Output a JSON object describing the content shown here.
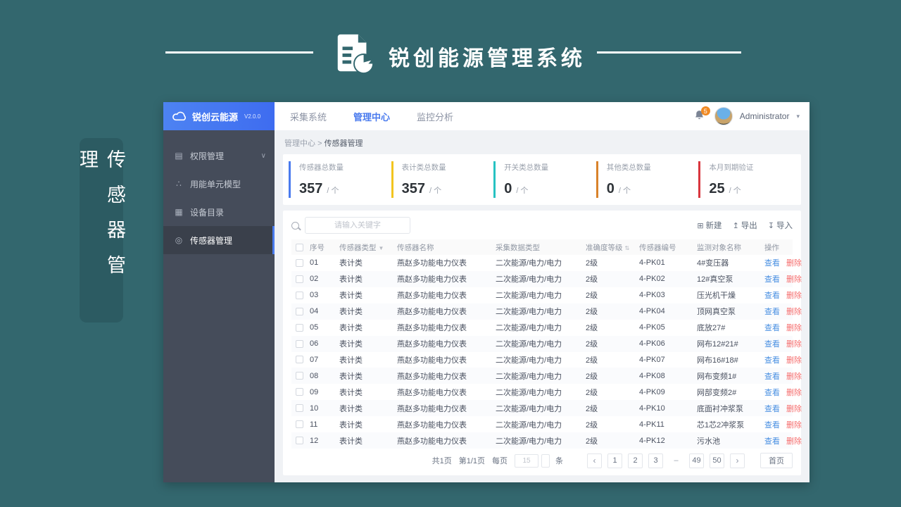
{
  "banner": {
    "title": "锐创能源管理系统"
  },
  "side_tag": {
    "label": "传感器管理"
  },
  "sidebar": {
    "brand": "锐创云能源",
    "version": "V2.0.0",
    "items": [
      {
        "label": "权限管理",
        "icon": "permission-icon",
        "glyph": "▤",
        "chevron": "∨",
        "active": false
      },
      {
        "label": "用能单元模型",
        "icon": "energy-unit-model-icon",
        "glyph": "∴",
        "chevron": "",
        "active": false
      },
      {
        "label": "设备目录",
        "icon": "device-catalog-icon",
        "glyph": "▦",
        "chevron": "",
        "active": false
      },
      {
        "label": "传感器管理",
        "icon": "sensor-manage-icon",
        "glyph": "◎",
        "chevron": "",
        "active": true
      }
    ]
  },
  "topnav": {
    "tabs": [
      {
        "label": "采集系统",
        "active": false
      },
      {
        "label": "管理中心",
        "active": true
      },
      {
        "label": "监控分析",
        "active": false
      }
    ],
    "notification_count": "5",
    "user_name": "Administrator",
    "caret": "▾"
  },
  "breadcrumb": {
    "parent": "管理中心",
    "separator": ">",
    "current": "传感器管理"
  },
  "stats": [
    {
      "label": "传感器总数量",
      "value": "357",
      "unit": "/ 个",
      "color": "#4a7bee"
    },
    {
      "label": "表计类总数量",
      "value": "357",
      "unit": "/ 个",
      "color": "#f2c51f"
    },
    {
      "label": "开关类总数量",
      "value": "0",
      "unit": "/ 个",
      "color": "#27c2c2"
    },
    {
      "label": "其他类总数量",
      "value": "0",
      "unit": "/ 个",
      "color": "#d9822b"
    },
    {
      "label": "本月到期验证",
      "value": "25",
      "unit": "/ 个",
      "color": "#d9363e"
    }
  ],
  "toolbar": {
    "search_placeholder": "请输入关键字",
    "buttons": [
      {
        "label": "新建",
        "icon": "new-icon",
        "glyph": "⊞"
      },
      {
        "label": "导出",
        "icon": "export-icon",
        "glyph": "↥"
      },
      {
        "label": "导入",
        "icon": "import-icon",
        "glyph": "↧"
      }
    ]
  },
  "table": {
    "headers": {
      "no": "序号",
      "type": "传感器类型",
      "name": "传感器名称",
      "dtype": "采集数据类型",
      "grade": "准确度等级",
      "code": "传感器编号",
      "target": "监测对象名称",
      "ops": "操作"
    },
    "filter_glyph": "▼",
    "sort_glyph": "⇅",
    "view_label": "查看",
    "delete_label": "删除",
    "rows": [
      {
        "no": "01",
        "type": "表计类",
        "name": "燕赵多功能电力仪表",
        "dtype": "二次能源/电力/电力",
        "grade": "2级",
        "code": "4-PK01",
        "target": "4#变压器"
      },
      {
        "no": "02",
        "type": "表计类",
        "name": "燕赵多功能电力仪表",
        "dtype": "二次能源/电力/电力",
        "grade": "2级",
        "code": "4-PK02",
        "target": "12#真空泵"
      },
      {
        "no": "03",
        "type": "表计类",
        "name": "燕赵多功能电力仪表",
        "dtype": "二次能源/电力/电力",
        "grade": "2级",
        "code": "4-PK03",
        "target": "压光机干燥"
      },
      {
        "no": "04",
        "type": "表计类",
        "name": "燕赵多功能电力仪表",
        "dtype": "二次能源/电力/电力",
        "grade": "2级",
        "code": "4-PK04",
        "target": "顶网真空泵"
      },
      {
        "no": "05",
        "type": "表计类",
        "name": "燕赵多功能电力仪表",
        "dtype": "二次能源/电力/电力",
        "grade": "2级",
        "code": "4-PK05",
        "target": "底放27#"
      },
      {
        "no": "06",
        "type": "表计类",
        "name": "燕赵多功能电力仪表",
        "dtype": "二次能源/电力/电力",
        "grade": "2级",
        "code": "4-PK06",
        "target": "网布12#21#"
      },
      {
        "no": "07",
        "type": "表计类",
        "name": "燕赵多功能电力仪表",
        "dtype": "二次能源/电力/电力",
        "grade": "2级",
        "code": "4-PK07",
        "target": "网布16#18#"
      },
      {
        "no": "08",
        "type": "表计类",
        "name": "燕赵多功能电力仪表",
        "dtype": "二次能源/电力/电力",
        "grade": "2级",
        "code": "4-PK08",
        "target": "网布变频1#"
      },
      {
        "no": "09",
        "type": "表计类",
        "name": "燕赵多功能电力仪表",
        "dtype": "二次能源/电力/电力",
        "grade": "2级",
        "code": "4-PK09",
        "target": "网部变频2#"
      },
      {
        "no": "10",
        "type": "表计类",
        "name": "燕赵多功能电力仪表",
        "dtype": "二次能源/电力/电力",
        "grade": "2级",
        "code": "4-PK10",
        "target": "底面衬冲浆泵"
      },
      {
        "no": "11",
        "type": "表计类",
        "name": "燕赵多功能电力仪表",
        "dtype": "二次能源/电力/电力",
        "grade": "2级",
        "code": "4-PK11",
        "target": "芯1芯2冲浆泵"
      },
      {
        "no": "12",
        "type": "表计类",
        "name": "燕赵多功能电力仪表",
        "dtype": "二次能源/电力/电力",
        "grade": "2级",
        "code": "4-PK12",
        "target": "污水池"
      }
    ]
  },
  "pagination": {
    "total_pages_text": "共1页",
    "current_page_text": "第1/1页",
    "per_page_label": "每页",
    "page_size": "15",
    "unit_label": "条",
    "prev_glyph": "‹",
    "next_glyph": "›",
    "pages": [
      {
        "label": "1",
        "box": true
      },
      {
        "label": "2",
        "box": true
      },
      {
        "label": "3",
        "box": true
      },
      {
        "label": "–",
        "box": false
      },
      {
        "label": "49",
        "box": true
      },
      {
        "label": "50",
        "box": true
      }
    ],
    "home_label": "首页"
  }
}
